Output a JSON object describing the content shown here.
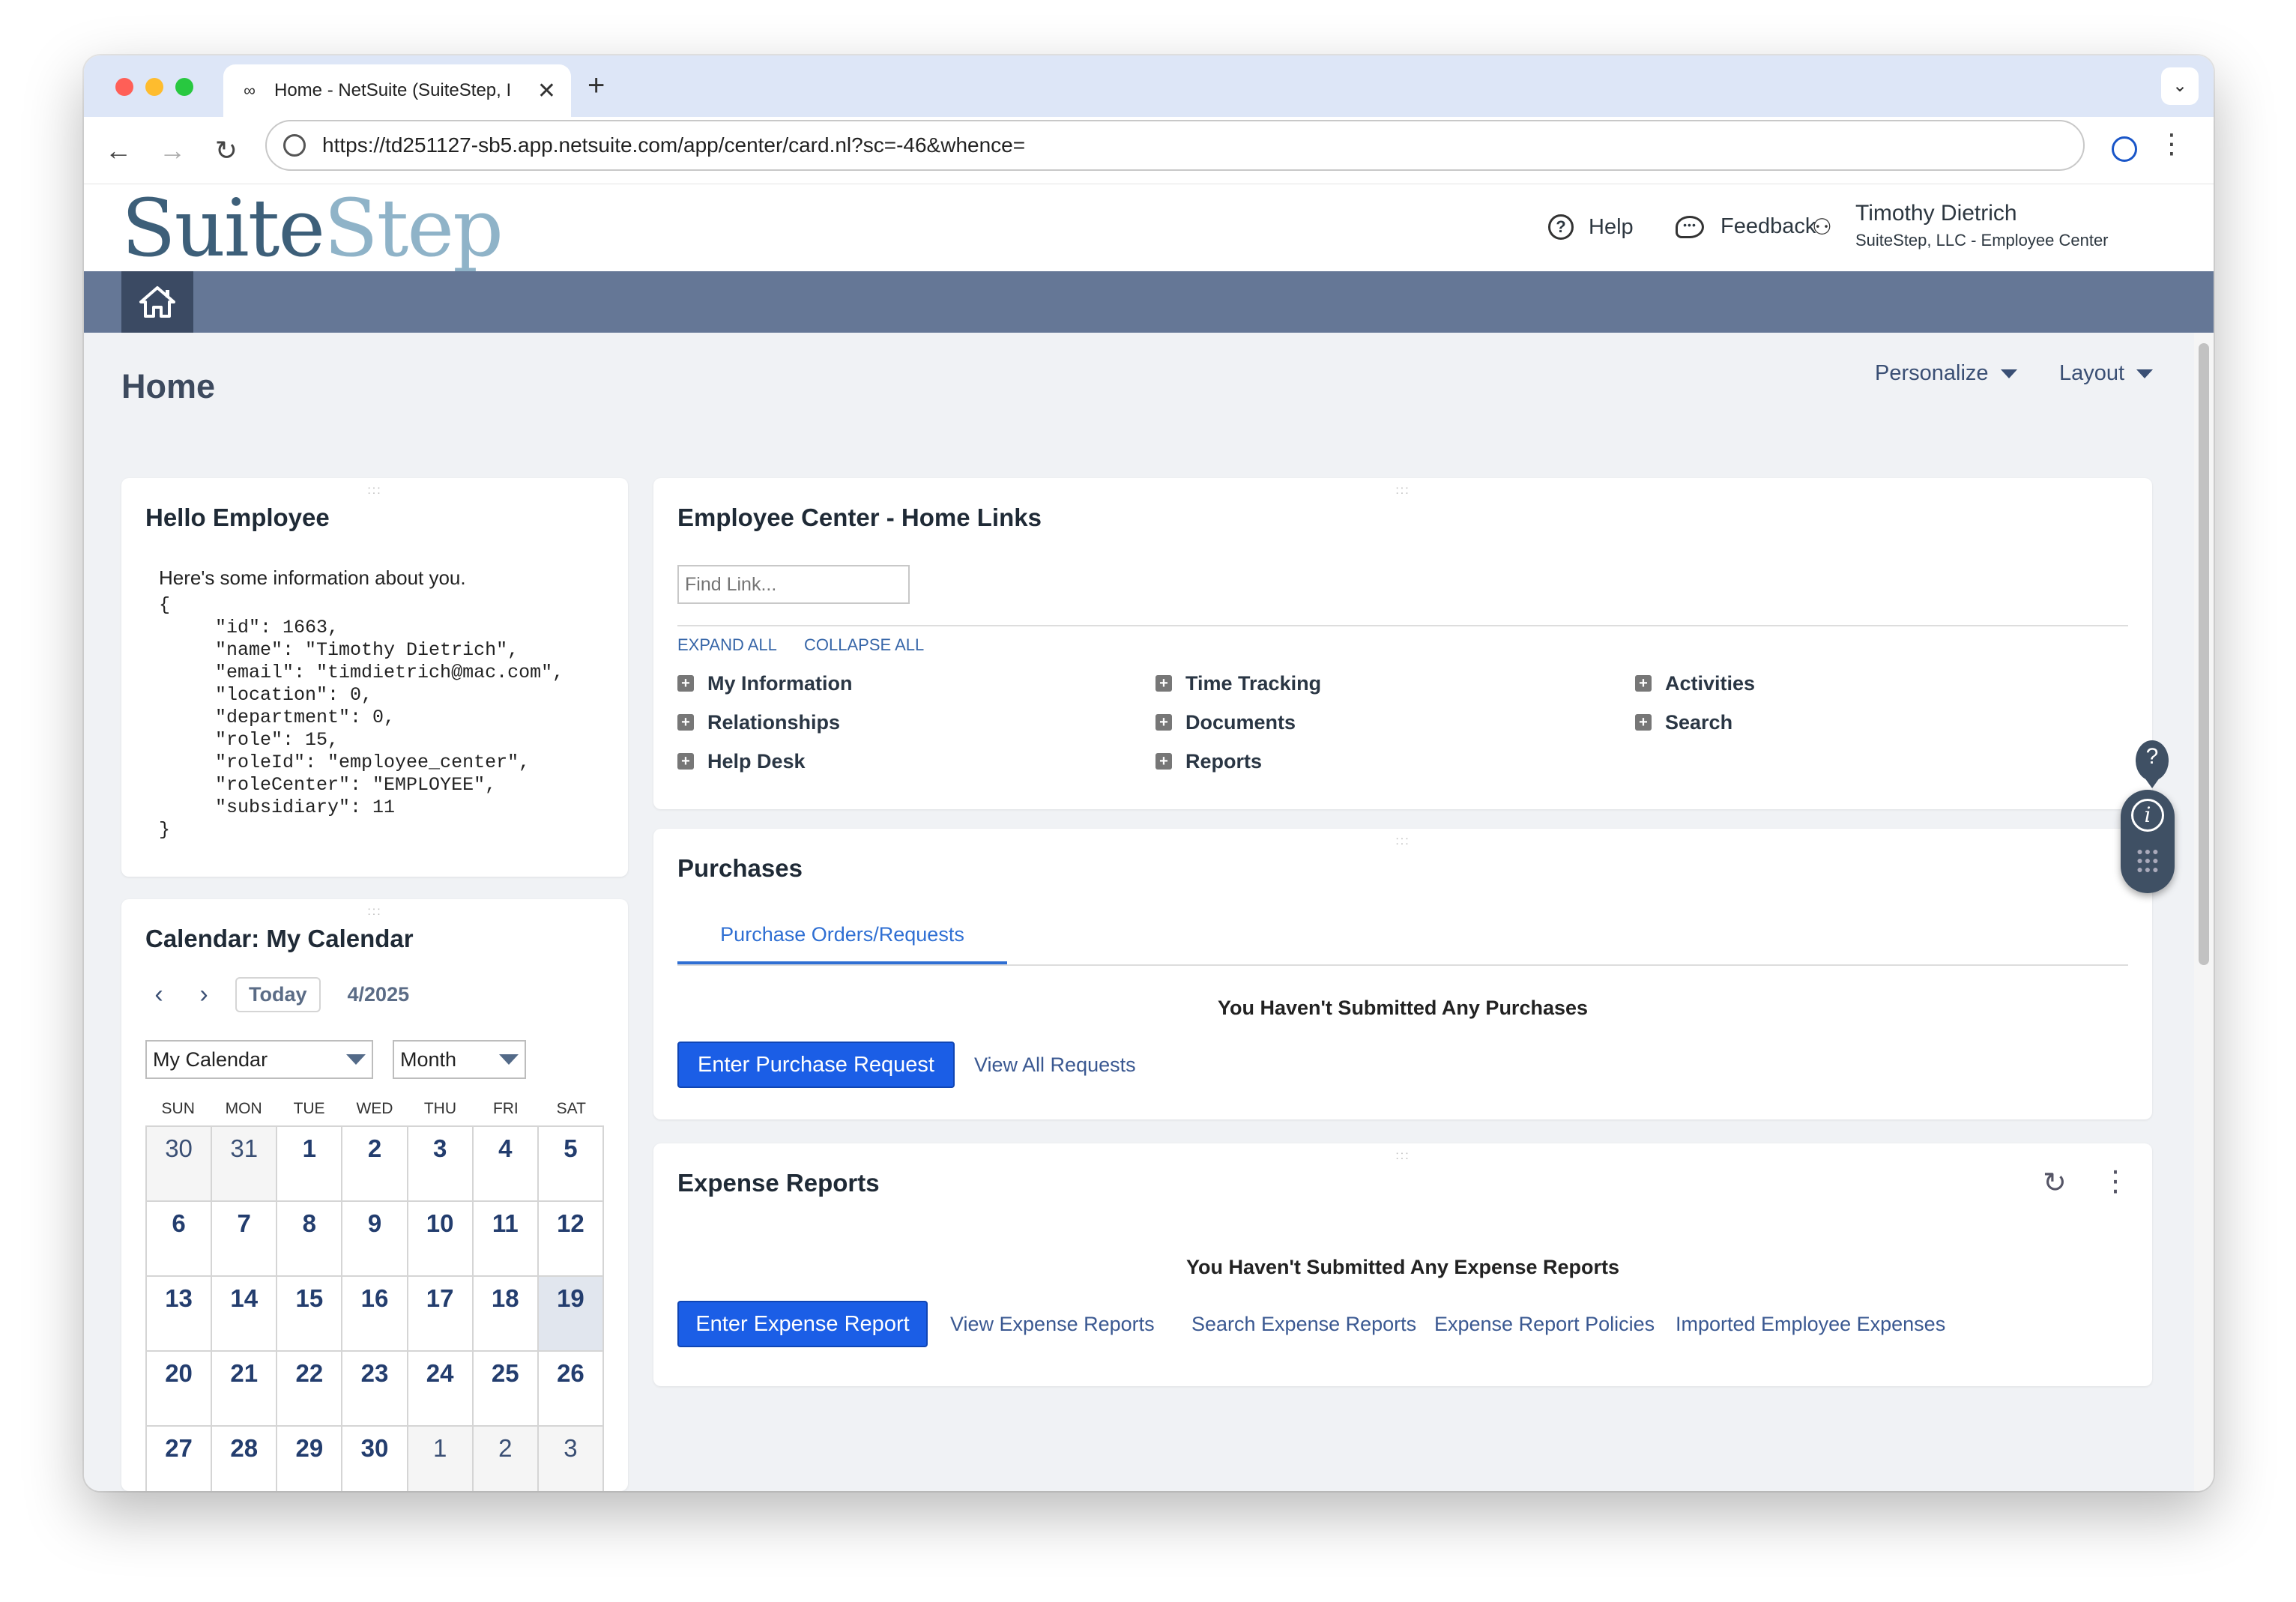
{
  "browser": {
    "tab_title": "Home - NetSuite (SuiteStep, I",
    "new_tab": "+",
    "close_tab": "✕",
    "url": "https://td251127-sb5.app.netsuite.com/app/center/card.nl?sc=-46&whence="
  },
  "header": {
    "logo_suite": "Suite",
    "logo_step": "Step",
    "help_label": "Help",
    "feedback_label": "Feedback",
    "user_name": "Timothy Dietrich",
    "user_org": "SuiteStep, LLC - Employee Center"
  },
  "page": {
    "title": "Home",
    "personalize_label": "Personalize",
    "layout_label": "Layout"
  },
  "hello": {
    "title": "Hello Employee",
    "intro": "Here's some information about you.",
    "json_text": "{\n     \"id\": 1663,\n     \"name\": \"Timothy Dietrich\",\n     \"email\": \"timdietrich@mac.com\",\n     \"location\": 0,\n     \"department\": 0,\n     \"role\": 15,\n     \"roleId\": \"employee_center\",\n     \"roleCenter\": \"EMPLOYEE\",\n     \"subsidiary\": 11\n}"
  },
  "calendar": {
    "title": "Calendar: My Calendar",
    "prev": "‹",
    "next": "›",
    "today_label": "Today",
    "month_label": "4/2025",
    "calendar_select": "My Calendar",
    "view_select": "Month",
    "weekdays": [
      "SUN",
      "MON",
      "TUE",
      "WED",
      "THU",
      "FRI",
      "SAT"
    ],
    "days": [
      {
        "d": "30",
        "other": true
      },
      {
        "d": "31",
        "other": true
      },
      {
        "d": "1"
      },
      {
        "d": "2"
      },
      {
        "d": "3"
      },
      {
        "d": "4"
      },
      {
        "d": "5"
      },
      {
        "d": "6"
      },
      {
        "d": "7"
      },
      {
        "d": "8"
      },
      {
        "d": "9"
      },
      {
        "d": "10"
      },
      {
        "d": "11"
      },
      {
        "d": "12"
      },
      {
        "d": "13"
      },
      {
        "d": "14"
      },
      {
        "d": "15"
      },
      {
        "d": "16"
      },
      {
        "d": "17"
      },
      {
        "d": "18"
      },
      {
        "d": "19",
        "current": true
      },
      {
        "d": "20"
      },
      {
        "d": "21"
      },
      {
        "d": "22"
      },
      {
        "d": "23"
      },
      {
        "d": "24"
      },
      {
        "d": "25"
      },
      {
        "d": "26"
      },
      {
        "d": "27"
      },
      {
        "d": "28"
      },
      {
        "d": "29"
      },
      {
        "d": "30"
      },
      {
        "d": "1",
        "other": true
      },
      {
        "d": "2",
        "other": true
      },
      {
        "d": "3",
        "other": true
      }
    ]
  },
  "home_links": {
    "title": "Employee Center - Home Links",
    "find_placeholder": "Find Link...",
    "expand_all": "EXPAND ALL",
    "collapse_all": "COLLAPSE ALL",
    "col1": [
      "My Information",
      "Relationships",
      "Help Desk"
    ],
    "col2": [
      "Time Tracking",
      "Documents",
      "Reports"
    ],
    "col3": [
      "Activities",
      "Search"
    ]
  },
  "purchases": {
    "title": "Purchases",
    "tab_label": "Purchase Orders/Requests",
    "empty_message": "You Haven't Submitted Any Purchases",
    "enter_button": "Enter Purchase Request",
    "view_all": "View All Requests"
  },
  "expenses": {
    "title": "Expense Reports",
    "empty_message": "You Haven't Submitted Any Expense Reports",
    "enter_button": "Enter Expense Report",
    "links": [
      "View Expense Reports",
      "Search Expense Reports",
      "Expense Report Policies",
      "Imported Employee Expenses"
    ]
  },
  "side_widget": {
    "help_glyph": "?",
    "info_glyph": "i"
  },
  "colors": {
    "accent_blue": "#1b5ee6",
    "navbar": "#657796",
    "home_button": "#3b4a63"
  }
}
